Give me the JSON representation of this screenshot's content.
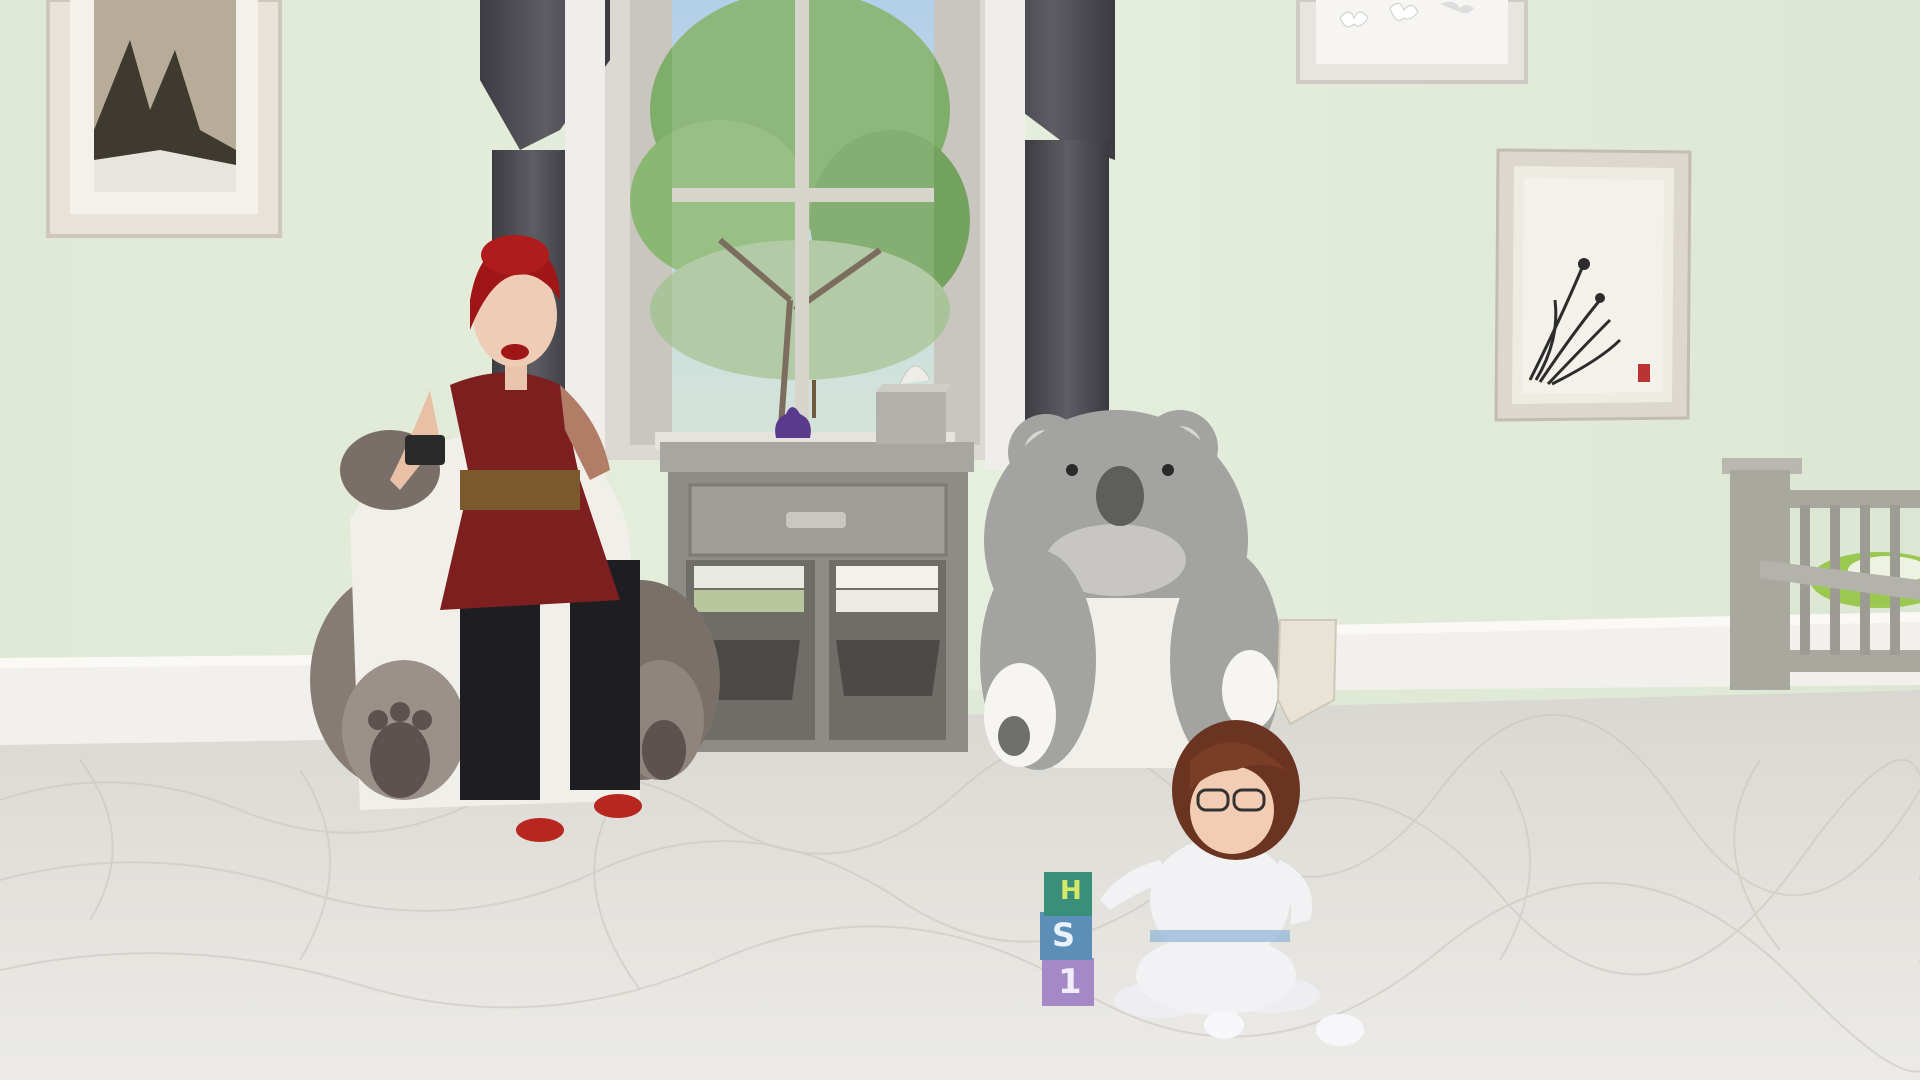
{
  "scene": {
    "type": "game-screenshot",
    "hud_visible": false
  },
  "colors": {
    "wall": "#dfeadb",
    "floor": "#e6e4df",
    "baseboard": "#f2f1ee",
    "curtain": "#4c4c52",
    "window_frame": "#d9d6cf",
    "foliage": "#7fae6a",
    "chair_gray": "#a3a3a1",
    "chair_white": "#f0eeea",
    "dress": "#7d1f1f",
    "hair_red": "#a01616",
    "hair_toddler": "#6a3420",
    "bed_green": "#9bc94f",
    "lotus": "#5a3a8c"
  },
  "icons": [
    "toy-blocks-icon"
  ],
  "blocks": {
    "block_top": "H",
    "block_middle": "S",
    "block_bottom": "1"
  }
}
